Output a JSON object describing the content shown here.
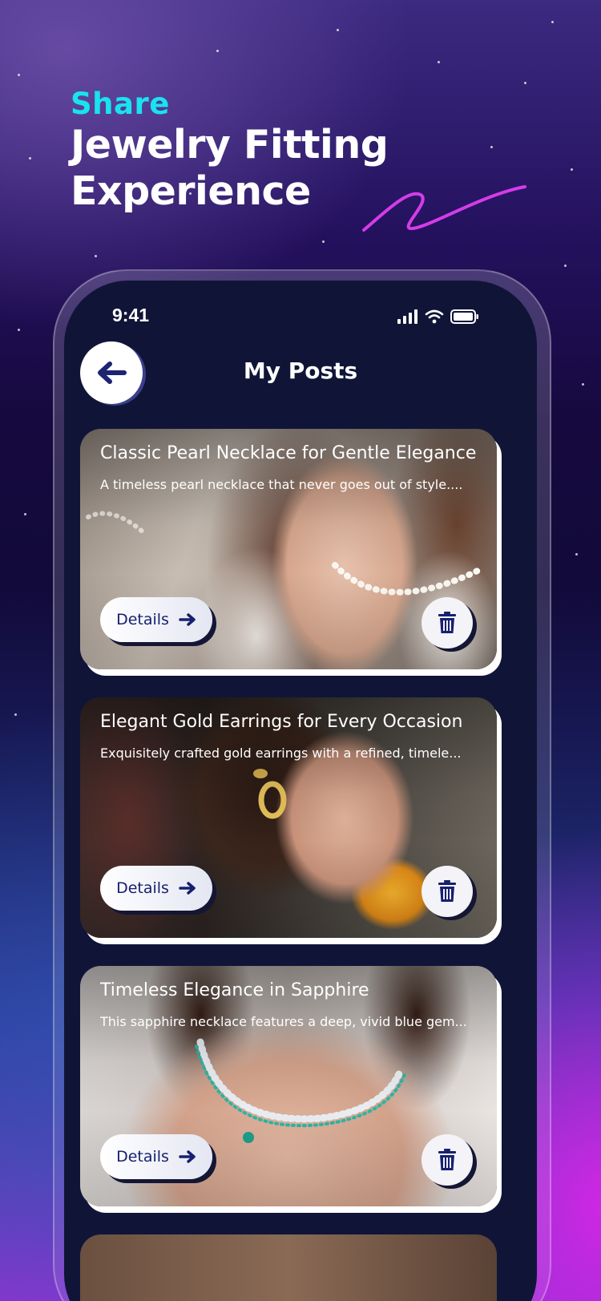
{
  "headline": {
    "share": "Share",
    "line1": "Jewelry Fitting",
    "line2": "Experience"
  },
  "status_bar": {
    "time": "9:41"
  },
  "header": {
    "title": "My Posts"
  },
  "posts": [
    {
      "title": "Classic Pearl Necklace for Gentle Elegance",
      "description": "A timeless pearl necklace that never goes out of style....",
      "details_label": "Details"
    },
    {
      "title": "Elegant Gold Earrings for Every Occasion",
      "description": "Exquisitely crafted gold earrings with a refined, timele...",
      "details_label": "Details"
    },
    {
      "title": "Timeless Elegance in Sapphire",
      "description": "This sapphire necklace features a deep, vivid blue gem...",
      "details_label": "Details"
    }
  ],
  "icons": {
    "back": "arrow-left-icon",
    "details": "arrow-right-icon",
    "delete": "trash-icon",
    "signal": "signal-icon",
    "wifi": "wifi-icon",
    "battery": "battery-icon"
  },
  "colors": {
    "accent_cyan": "#19e3f0",
    "swoosh_magenta": "#d43ce8",
    "screen_bg": "#101538",
    "button_text": "#17206e"
  }
}
